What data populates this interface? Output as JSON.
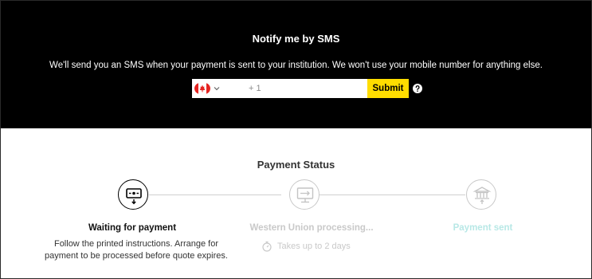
{
  "sms": {
    "title": "Notify me by SMS",
    "description": "We'll send you an SMS when your payment is sent to your institution. We won't use your mobile number for anything else.",
    "country_flag": "canada-flag-icon",
    "dial_code": "+ 1",
    "phone_value": "",
    "submit_label": "Submit",
    "help_icon": "question-circle-icon"
  },
  "status": {
    "title": "Payment Status",
    "steps": [
      {
        "label": "Waiting for payment",
        "description": "Follow the printed instructions. Arrange for payment to be processed before quote expires.",
        "icon": "cash-payment-icon",
        "state": "active"
      },
      {
        "label": "Western Union processing...",
        "eta": "Takes up to 2 days",
        "icon": "monitor-processing-icon",
        "eta_icon": "stopwatch-icon",
        "state": "pending"
      },
      {
        "label": "Payment sent",
        "icon": "bank-icon",
        "state": "pending"
      }
    ]
  },
  "colors": {
    "panel_bg": "#000000",
    "accent_yellow": "#ffdd00",
    "pending_gray": "#c9c9c9",
    "sent_teal": "#b8e8e6",
    "line_gray": "#cfcfcf"
  }
}
